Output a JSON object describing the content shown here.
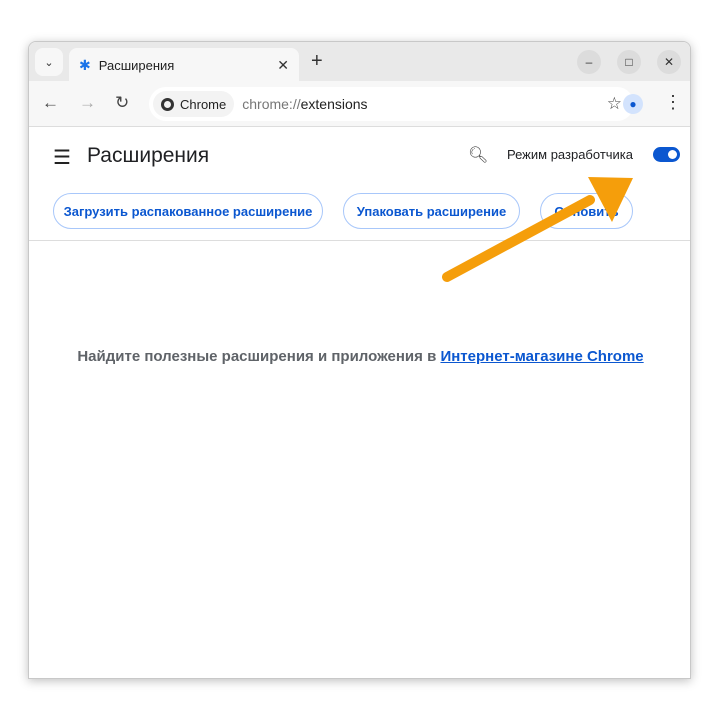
{
  "tab": {
    "title": "Расширения"
  },
  "omnibox": {
    "chip": "Chrome",
    "url_scheme": "chrome://",
    "url_host": "extensions"
  },
  "page": {
    "title": "Расширения",
    "dev_mode_label": "Режим разработчика",
    "dev_mode_on": true,
    "buttons": [
      "Загрузить распакованное расширение",
      "Упаковать расширение",
      "Обновить"
    ],
    "message": "Найдите полезные расширения и приложения в ",
    "store_link": "Интернет-магазине Chrome"
  },
  "annotation": {
    "arrow_color": "#f59e0b"
  },
  "colors": {
    "accent": "#0b57d0"
  }
}
